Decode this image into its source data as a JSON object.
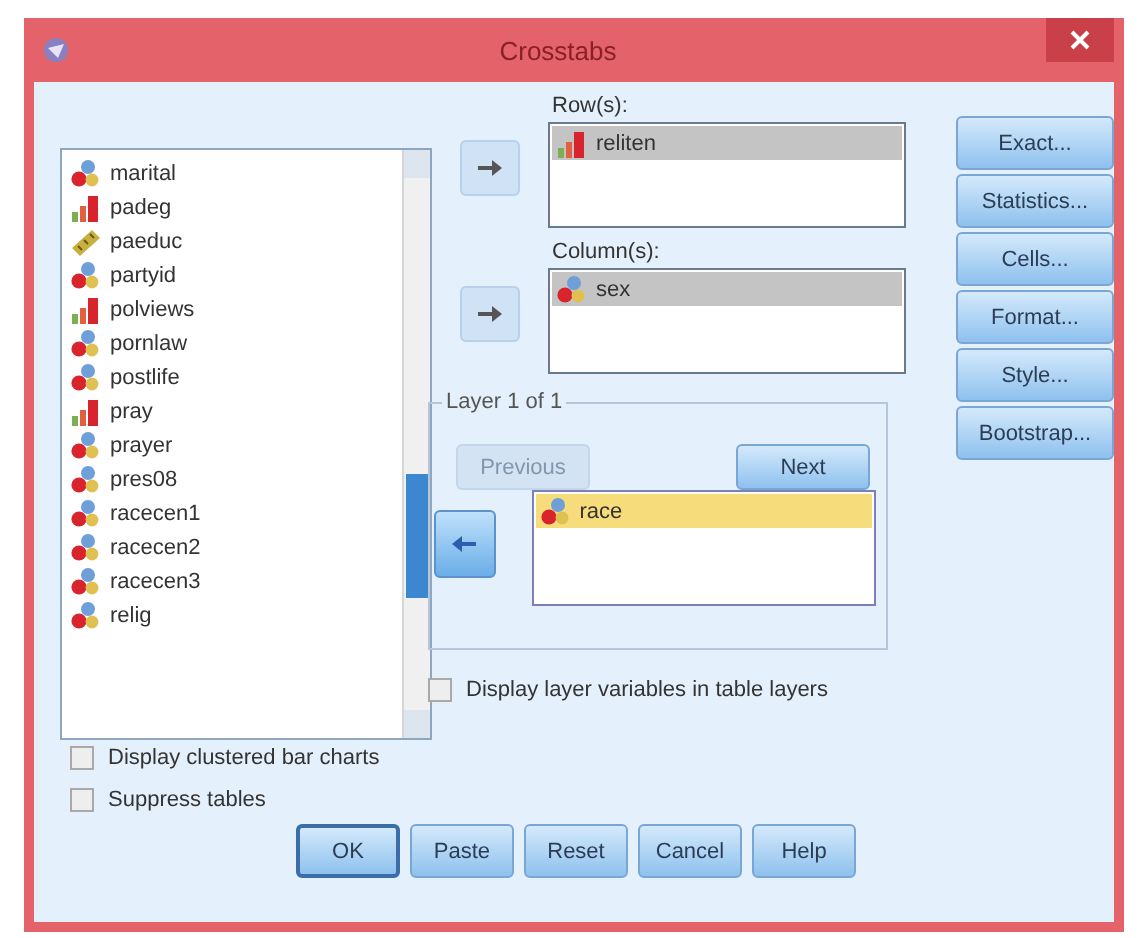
{
  "window": {
    "title": "Crosstabs"
  },
  "variables": [
    {
      "name": "marital",
      "kind": "nominal",
      "selected": false
    },
    {
      "name": "padeg",
      "kind": "ordinal",
      "selected": false
    },
    {
      "name": "paeduc",
      "kind": "scale",
      "selected": false
    },
    {
      "name": "partyid",
      "kind": "nominal",
      "selected": false
    },
    {
      "name": "polviews",
      "kind": "ordinal",
      "selected": false
    },
    {
      "name": "pornlaw",
      "kind": "nominal",
      "selected": false
    },
    {
      "name": "postlife",
      "kind": "nominal",
      "selected": false
    },
    {
      "name": "pray",
      "kind": "ordinal",
      "selected": false
    },
    {
      "name": "prayer",
      "kind": "nominal",
      "selected": false
    },
    {
      "name": "pres08",
      "kind": "nominal",
      "selected": false
    },
    {
      "name": "racecen1",
      "kind": "nominal",
      "selected": false
    },
    {
      "name": "racecen2",
      "kind": "nominal",
      "selected": false
    },
    {
      "name": "racecen3",
      "kind": "nominal",
      "selected": false
    },
    {
      "name": "relig",
      "kind": "nominal",
      "selected": false
    }
  ],
  "rows": {
    "label": "Row(s):",
    "items": [
      {
        "name": "reliten",
        "kind": "ordinal",
        "selected": true
      }
    ]
  },
  "columns": {
    "label": "Column(s):",
    "items": [
      {
        "name": "sex",
        "kind": "nominal",
        "selected": true
      }
    ]
  },
  "layer": {
    "label": "Layer 1 of 1",
    "previous": {
      "label": "Previous",
      "disabled": true
    },
    "next": {
      "label": "Next",
      "disabled": false
    },
    "items": [
      {
        "name": "race",
        "kind": "nominal",
        "selected": true
      }
    ]
  },
  "layer_option": {
    "label": "Display layer variables in table layers",
    "checked": false
  },
  "side_buttons": [
    "Exact...",
    "Statistics...",
    "Cells...",
    "Format...",
    "Style...",
    "Bootstrap..."
  ],
  "options": [
    {
      "label": "Display clustered bar charts",
      "checked": false
    },
    {
      "label": "Suppress tables",
      "checked": false
    }
  ],
  "buttons": [
    {
      "label": "OK",
      "default": true
    },
    {
      "label": "Paste",
      "default": false
    },
    {
      "label": "Reset",
      "default": false
    },
    {
      "label": "Cancel",
      "default": false
    },
    {
      "label": "Help",
      "default": false
    }
  ]
}
